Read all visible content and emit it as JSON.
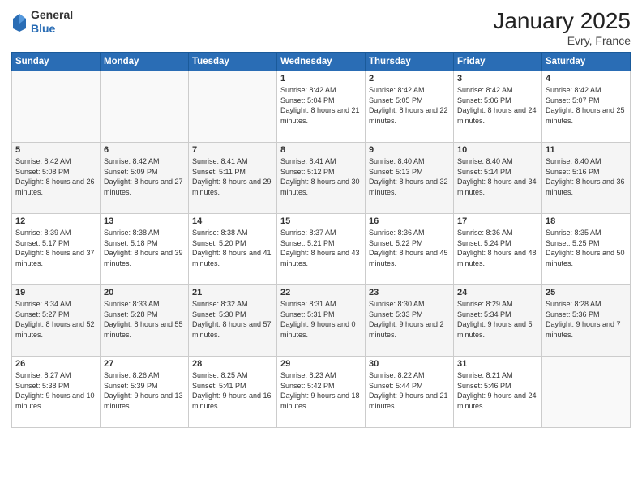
{
  "logo": {
    "general": "General",
    "blue": "Blue"
  },
  "header": {
    "month": "January 2025",
    "location": "Evry, France"
  },
  "days_of_week": [
    "Sunday",
    "Monday",
    "Tuesday",
    "Wednesday",
    "Thursday",
    "Friday",
    "Saturday"
  ],
  "weeks": [
    [
      {
        "day": "",
        "sunrise": "",
        "sunset": "",
        "daylight": ""
      },
      {
        "day": "",
        "sunrise": "",
        "sunset": "",
        "daylight": ""
      },
      {
        "day": "",
        "sunrise": "",
        "sunset": "",
        "daylight": ""
      },
      {
        "day": "1",
        "sunrise": "Sunrise: 8:42 AM",
        "sunset": "Sunset: 5:04 PM",
        "daylight": "Daylight: 8 hours and 21 minutes."
      },
      {
        "day": "2",
        "sunrise": "Sunrise: 8:42 AM",
        "sunset": "Sunset: 5:05 PM",
        "daylight": "Daylight: 8 hours and 22 minutes."
      },
      {
        "day": "3",
        "sunrise": "Sunrise: 8:42 AM",
        "sunset": "Sunset: 5:06 PM",
        "daylight": "Daylight: 8 hours and 24 minutes."
      },
      {
        "day": "4",
        "sunrise": "Sunrise: 8:42 AM",
        "sunset": "Sunset: 5:07 PM",
        "daylight": "Daylight: 8 hours and 25 minutes."
      }
    ],
    [
      {
        "day": "5",
        "sunrise": "Sunrise: 8:42 AM",
        "sunset": "Sunset: 5:08 PM",
        "daylight": "Daylight: 8 hours and 26 minutes."
      },
      {
        "day": "6",
        "sunrise": "Sunrise: 8:42 AM",
        "sunset": "Sunset: 5:09 PM",
        "daylight": "Daylight: 8 hours and 27 minutes."
      },
      {
        "day": "7",
        "sunrise": "Sunrise: 8:41 AM",
        "sunset": "Sunset: 5:11 PM",
        "daylight": "Daylight: 8 hours and 29 minutes."
      },
      {
        "day": "8",
        "sunrise": "Sunrise: 8:41 AM",
        "sunset": "Sunset: 5:12 PM",
        "daylight": "Daylight: 8 hours and 30 minutes."
      },
      {
        "day": "9",
        "sunrise": "Sunrise: 8:40 AM",
        "sunset": "Sunset: 5:13 PM",
        "daylight": "Daylight: 8 hours and 32 minutes."
      },
      {
        "day": "10",
        "sunrise": "Sunrise: 8:40 AM",
        "sunset": "Sunset: 5:14 PM",
        "daylight": "Daylight: 8 hours and 34 minutes."
      },
      {
        "day": "11",
        "sunrise": "Sunrise: 8:40 AM",
        "sunset": "Sunset: 5:16 PM",
        "daylight": "Daylight: 8 hours and 36 minutes."
      }
    ],
    [
      {
        "day": "12",
        "sunrise": "Sunrise: 8:39 AM",
        "sunset": "Sunset: 5:17 PM",
        "daylight": "Daylight: 8 hours and 37 minutes."
      },
      {
        "day": "13",
        "sunrise": "Sunrise: 8:38 AM",
        "sunset": "Sunset: 5:18 PM",
        "daylight": "Daylight: 8 hours and 39 minutes."
      },
      {
        "day": "14",
        "sunrise": "Sunrise: 8:38 AM",
        "sunset": "Sunset: 5:20 PM",
        "daylight": "Daylight: 8 hours and 41 minutes."
      },
      {
        "day": "15",
        "sunrise": "Sunrise: 8:37 AM",
        "sunset": "Sunset: 5:21 PM",
        "daylight": "Daylight: 8 hours and 43 minutes."
      },
      {
        "day": "16",
        "sunrise": "Sunrise: 8:36 AM",
        "sunset": "Sunset: 5:22 PM",
        "daylight": "Daylight: 8 hours and 45 minutes."
      },
      {
        "day": "17",
        "sunrise": "Sunrise: 8:36 AM",
        "sunset": "Sunset: 5:24 PM",
        "daylight": "Daylight: 8 hours and 48 minutes."
      },
      {
        "day": "18",
        "sunrise": "Sunrise: 8:35 AM",
        "sunset": "Sunset: 5:25 PM",
        "daylight": "Daylight: 8 hours and 50 minutes."
      }
    ],
    [
      {
        "day": "19",
        "sunrise": "Sunrise: 8:34 AM",
        "sunset": "Sunset: 5:27 PM",
        "daylight": "Daylight: 8 hours and 52 minutes."
      },
      {
        "day": "20",
        "sunrise": "Sunrise: 8:33 AM",
        "sunset": "Sunset: 5:28 PM",
        "daylight": "Daylight: 8 hours and 55 minutes."
      },
      {
        "day": "21",
        "sunrise": "Sunrise: 8:32 AM",
        "sunset": "Sunset: 5:30 PM",
        "daylight": "Daylight: 8 hours and 57 minutes."
      },
      {
        "day": "22",
        "sunrise": "Sunrise: 8:31 AM",
        "sunset": "Sunset: 5:31 PM",
        "daylight": "Daylight: 9 hours and 0 minutes."
      },
      {
        "day": "23",
        "sunrise": "Sunrise: 8:30 AM",
        "sunset": "Sunset: 5:33 PM",
        "daylight": "Daylight: 9 hours and 2 minutes."
      },
      {
        "day": "24",
        "sunrise": "Sunrise: 8:29 AM",
        "sunset": "Sunset: 5:34 PM",
        "daylight": "Daylight: 9 hours and 5 minutes."
      },
      {
        "day": "25",
        "sunrise": "Sunrise: 8:28 AM",
        "sunset": "Sunset: 5:36 PM",
        "daylight": "Daylight: 9 hours and 7 minutes."
      }
    ],
    [
      {
        "day": "26",
        "sunrise": "Sunrise: 8:27 AM",
        "sunset": "Sunset: 5:38 PM",
        "daylight": "Daylight: 9 hours and 10 minutes."
      },
      {
        "day": "27",
        "sunrise": "Sunrise: 8:26 AM",
        "sunset": "Sunset: 5:39 PM",
        "daylight": "Daylight: 9 hours and 13 minutes."
      },
      {
        "day": "28",
        "sunrise": "Sunrise: 8:25 AM",
        "sunset": "Sunset: 5:41 PM",
        "daylight": "Daylight: 9 hours and 16 minutes."
      },
      {
        "day": "29",
        "sunrise": "Sunrise: 8:23 AM",
        "sunset": "Sunset: 5:42 PM",
        "daylight": "Daylight: 9 hours and 18 minutes."
      },
      {
        "day": "30",
        "sunrise": "Sunrise: 8:22 AM",
        "sunset": "Sunset: 5:44 PM",
        "daylight": "Daylight: 9 hours and 21 minutes."
      },
      {
        "day": "31",
        "sunrise": "Sunrise: 8:21 AM",
        "sunset": "Sunset: 5:46 PM",
        "daylight": "Daylight: 9 hours and 24 minutes."
      },
      {
        "day": "",
        "sunrise": "",
        "sunset": "",
        "daylight": ""
      }
    ]
  ]
}
